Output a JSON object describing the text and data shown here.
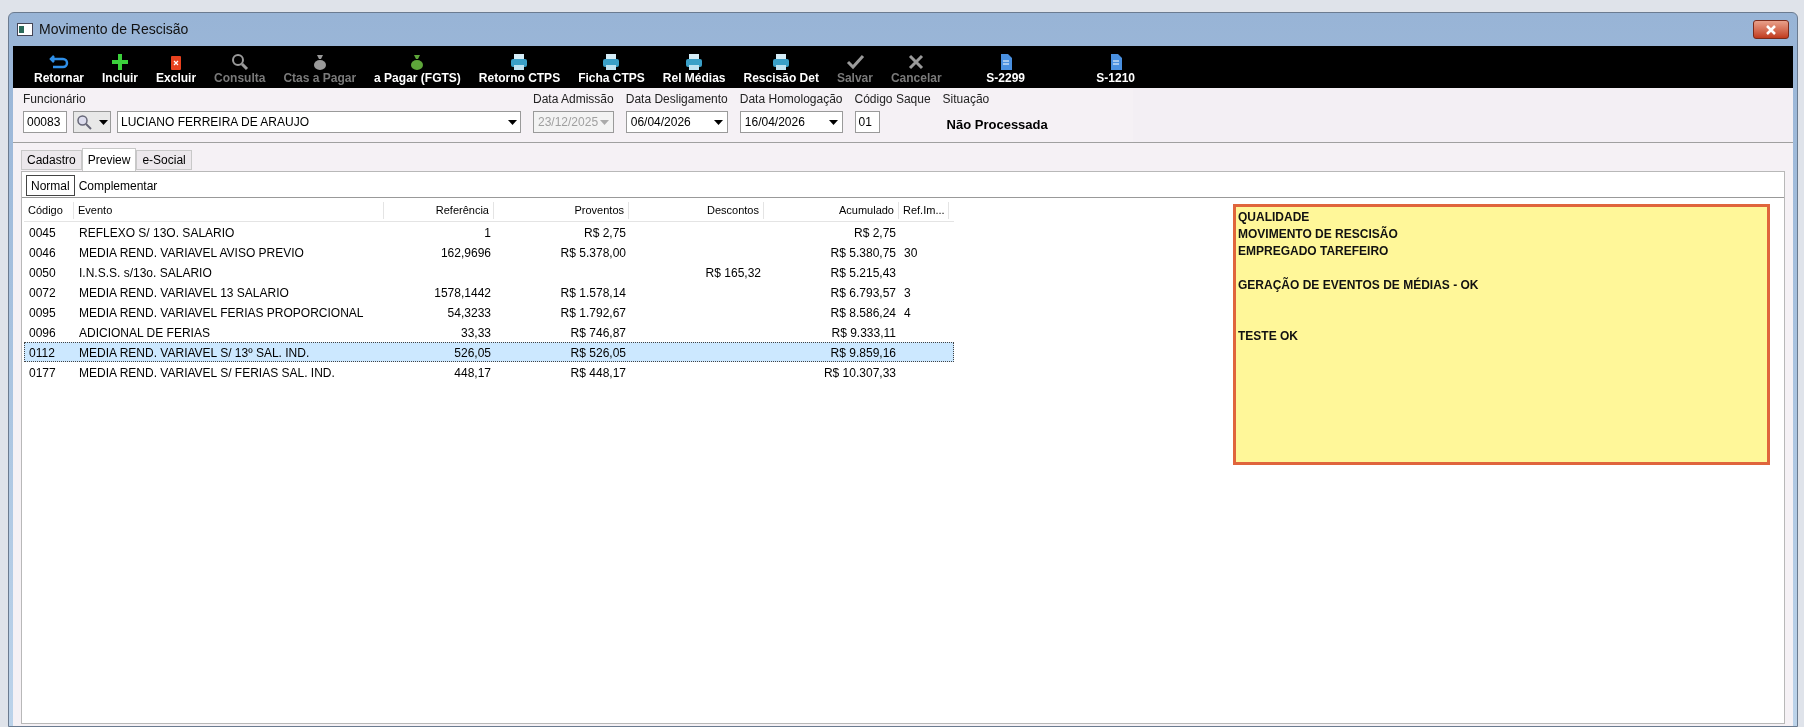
{
  "window": {
    "title": "Movimento de Rescisão"
  },
  "toolbar": [
    {
      "label": "Retornar",
      "disabled": false
    },
    {
      "label": "Incluir",
      "disabled": false
    },
    {
      "label": "Excluir",
      "disabled": false
    },
    {
      "label": "Consulta",
      "disabled": true
    },
    {
      "label": "Ctas a Pagar",
      "disabled": true
    },
    {
      "label": "a Pagar (FGTS)",
      "disabled": false
    },
    {
      "label": "Retorno CTPS",
      "disabled": false
    },
    {
      "label": "Ficha CTPS",
      "disabled": false
    },
    {
      "label": "Rel Médias",
      "disabled": false
    },
    {
      "label": "Rescisão Det",
      "disabled": false
    },
    {
      "label": "Salvar",
      "disabled": true
    },
    {
      "label": "Cancelar",
      "disabled": true
    },
    {
      "label": "S-2299",
      "disabled": false
    },
    {
      "label": "S-1210",
      "disabled": false
    }
  ],
  "form": {
    "funcionario": {
      "label": "Funcionário",
      "code": "00083",
      "name": "LUCIANO FERREIRA DE ARAUJO"
    },
    "data_admissao": {
      "label": "Data Admissão",
      "value": "23/12/2025",
      "disabled": true
    },
    "data_desligamento": {
      "label": "Data Desligamento",
      "value": "06/04/2026",
      "disabled": false
    },
    "data_homologacao": {
      "label": "Data Homologação",
      "value": "16/04/2026",
      "disabled": false
    },
    "codigo_saque": {
      "label": "Código Saque",
      "value": "01"
    },
    "situacao": {
      "label": "Situação",
      "value": "Não Processada"
    }
  },
  "tabs": [
    {
      "label": "Cadastro",
      "selected": false
    },
    {
      "label": "Preview",
      "selected": true
    },
    {
      "label": "e-Social",
      "selected": false
    }
  ],
  "subtabs": [
    {
      "label": "Normal",
      "selected": true
    },
    {
      "label": "Complementar",
      "selected": false
    }
  ],
  "table": {
    "columns": [
      "Código",
      "Evento",
      "Referência",
      "Proventos",
      "Descontos",
      "Acumulado",
      "Ref.Im..."
    ],
    "rows": [
      {
        "cells": [
          "0045",
          "REFLEXO S/ 13O. SALARIO",
          "1",
          "R$ 2,75",
          "",
          "R$ 2,75",
          ""
        ],
        "selected": false
      },
      {
        "cells": [
          "0046",
          "MEDIA REND. VARIAVEL AVISO PREVIO",
          "162,9696",
          "R$ 5.378,00",
          "",
          "R$ 5.380,75",
          "30"
        ],
        "selected": false
      },
      {
        "cells": [
          "0050",
          "I.N.S.S. s/13o. SALARIO",
          "",
          "",
          "R$ 165,32",
          "R$ 5.215,43",
          ""
        ],
        "selected": false
      },
      {
        "cells": [
          "0072",
          "MEDIA REND. VARIAVEL 13 SALARIO",
          "1578,1442",
          "R$ 1.578,14",
          "",
          "R$ 6.793,57",
          "3"
        ],
        "selected": false
      },
      {
        "cells": [
          "0095",
          "MEDIA REND. VARIAVEL FERIAS PROPORCIONAL",
          "54,3233",
          "R$ 1.792,67",
          "",
          "R$ 8.586,24",
          "4"
        ],
        "selected": false
      },
      {
        "cells": [
          "0096",
          "ADICIONAL DE FERIAS",
          "33,33",
          "R$ 746,87",
          "",
          "R$ 9.333,11",
          ""
        ],
        "selected": false
      },
      {
        "cells": [
          "0112",
          "MEDIA REND. VARIAVEL S/ 13º SAL. IND.",
          "526,05",
          "R$ 526,05",
          "",
          "R$ 9.859,16",
          ""
        ],
        "selected": true
      },
      {
        "cells": [
          "0177",
          "MEDIA REND. VARIAVEL S/ FERIAS SAL. IND.",
          "448,17",
          "R$ 448,17",
          "",
          "R$ 10.307,33",
          ""
        ],
        "selected": false
      }
    ]
  },
  "note": {
    "lines": [
      {
        "text": "QUALIDADE",
        "kind": "line"
      },
      {
        "text": "MOVIMENTO DE RESCISÃO",
        "kind": "line"
      },
      {
        "text": "EMPREGADO TAREFEIRO",
        "kind": "line"
      },
      {
        "text": "GERAÇÃO DE EVENTOS DE MÉDIAS - OK",
        "kind": "after_blank"
      },
      {
        "text": "TESTE OK",
        "kind": "after_two_blanks"
      }
    ]
  }
}
